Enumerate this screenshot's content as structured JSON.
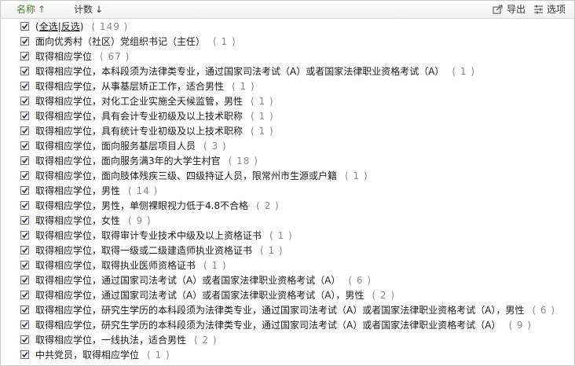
{
  "toolbar": {
    "sort_name_label": "名称",
    "sort_name_arrow": "↑",
    "sort_count_label": "计数",
    "sort_count_arrow": "↓",
    "export_label": "导出",
    "options_label": "选项"
  },
  "select_row": {
    "select_all": "全选",
    "invert": "反选",
    "open_paren": "(",
    "close_paren": ")",
    "separator": "|",
    "count": "( 149 )"
  },
  "items": [
    {
      "label": "面向优秀村（社区）党组织书记（主任）",
      "count": "( 1 )"
    },
    {
      "label": "取得相应学位",
      "count": "( 67 )"
    },
    {
      "label": "取得相应学位，本科段须为法律类专业，通过国家司法考试（A）或者国家法律职业资格考试（A）",
      "count": "( 1 )"
    },
    {
      "label": "取得相应学位，从事基层矫正工作，适合男性",
      "count": "( 1 )"
    },
    {
      "label": "取得相应学位，对化工企业实施全天候监管，男性",
      "count": "( 1 )"
    },
    {
      "label": "取得相应学位，具有会计专业初级及以上技术职称",
      "count": "( 1 )"
    },
    {
      "label": "取得相应学位，具有统计专业初级及以上技术职称",
      "count": "( 1 )"
    },
    {
      "label": "取得相应学位，面向服务基层项目人员",
      "count": "( 3 )"
    },
    {
      "label": "取得相应学位，面向服务满3年的大学生村官",
      "count": "( 18 )"
    },
    {
      "label": "取得相应学位，面向肢体残疾三级、四级持证人员，限常州市生源或户籍",
      "count": "( 1 )"
    },
    {
      "label": "取得相应学位，男性",
      "count": "( 14 )"
    },
    {
      "label": "取得相应学位，男性，单侧裸眼视力低于4.8不合格",
      "count": "( 2 )"
    },
    {
      "label": "取得相应学位，女性",
      "count": "( 9 )"
    },
    {
      "label": "取得相应学位，取得审计专业技术中级及以上资格证书",
      "count": "( 1 )"
    },
    {
      "label": "取得相应学位，取得一级或二级建造师执业资格证书",
      "count": "( 1 )"
    },
    {
      "label": "取得相应学位，取得执业医师资格证书",
      "count": "( 1 )"
    },
    {
      "label": "取得相应学位，通过国家司法考试（A）或者国家法律职业资格考试（A）",
      "count": "( 6 )"
    },
    {
      "label": "取得相应学位，通过国家司法考试（A）或者国家法律职业资格考试（A），男性",
      "count": "( 2 )"
    },
    {
      "label": "取得相应学位，研究生学历的本科段须为法律类专业，通过国家司法考试（A）或者国家法律职业资格考试（A），男性",
      "count": "( 6 )"
    },
    {
      "label": "取得相应学位，研究生学历的本科段须为法律类专业，通过国家司法考试（A）或者国家法律职业资格考试（A）",
      "count": "( 9 )"
    },
    {
      "label": "取得相应学位，一线执法，适合男性",
      "count": "( 2 )"
    },
    {
      "label": "中共党员，取得相应学位",
      "count": "( 1 )"
    }
  ]
}
